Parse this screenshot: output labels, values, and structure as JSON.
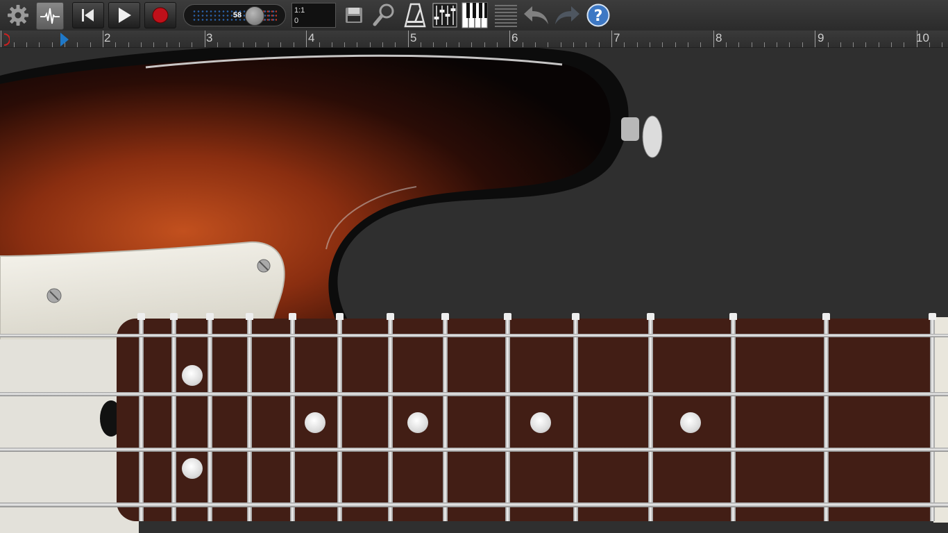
{
  "toolbar": {
    "tempo": {
      "value": "58",
      "level": 0.72
    },
    "position": {
      "bar_beat": "1:1",
      "tick": "0"
    },
    "icons": [
      "settings-gear-icon",
      "waveform-icon",
      "rewind-to-start-icon",
      "play-icon",
      "record-icon",
      "save-icon",
      "zoom-icon",
      "metronome-icon",
      "mixer-icon",
      "piano-keyboard-icon",
      "tracks-list-icon",
      "undo-icon",
      "redo-icon",
      "help-icon"
    ]
  },
  "ruler": {
    "labels": [
      "2",
      "3",
      "4",
      "5",
      "6",
      "7",
      "8",
      "9",
      "10"
    ]
  },
  "instrument": {
    "name": "bass-guitar",
    "body_color": "#7a2a10",
    "fretboard_color": "#4a2318",
    "string_count": 4,
    "fret_count": 14
  },
  "colors": {
    "background": "#2f2f2f",
    "record": "#c0101a",
    "tempo_dots": "#2b62a8",
    "playhead": "#1e78c8"
  }
}
